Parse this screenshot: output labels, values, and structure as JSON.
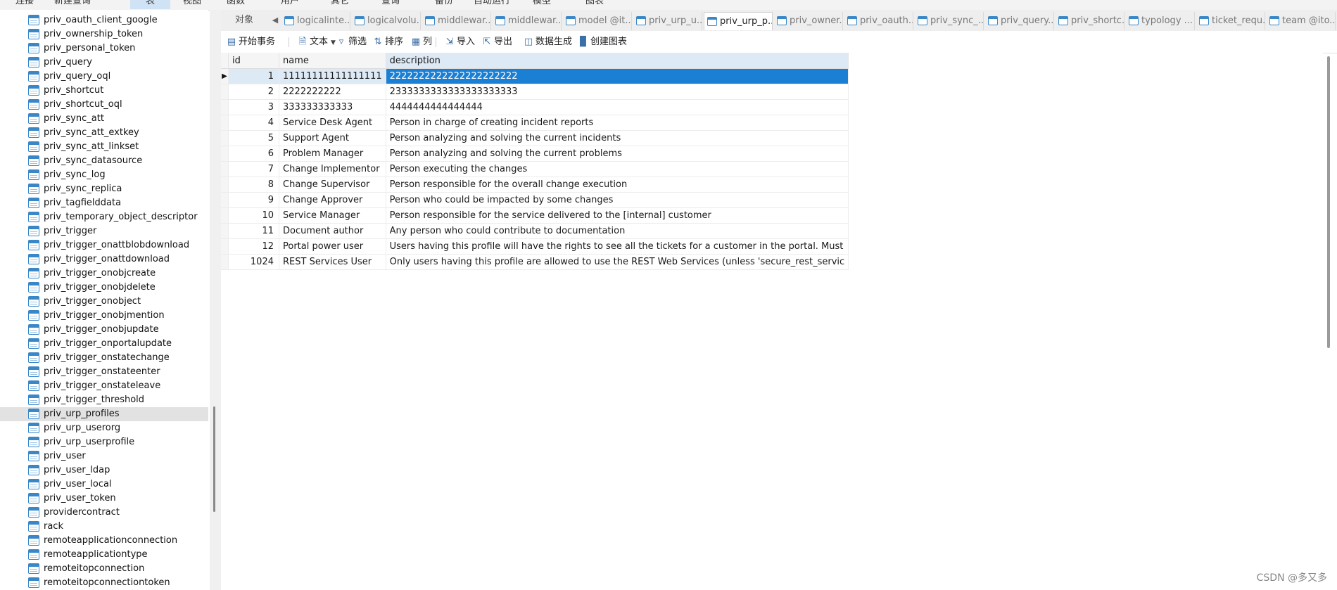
{
  "top_menu": [
    "连接",
    "新建查询",
    "表",
    "视图",
    "函数",
    "用户",
    "其它",
    "查询",
    "备份",
    "自动运行",
    "模型",
    "图表"
  ],
  "top_menu_active": "表",
  "sidebar": {
    "items": [
      "priv_oauth_client_google",
      "priv_ownership_token",
      "priv_personal_token",
      "priv_query",
      "priv_query_oql",
      "priv_shortcut",
      "priv_shortcut_oql",
      "priv_sync_att",
      "priv_sync_att_extkey",
      "priv_sync_att_linkset",
      "priv_sync_datasource",
      "priv_sync_log",
      "priv_sync_replica",
      "priv_tagfielddata",
      "priv_temporary_object_descriptor",
      "priv_trigger",
      "priv_trigger_onattblobdownload",
      "priv_trigger_onattdownload",
      "priv_trigger_onobjcreate",
      "priv_trigger_onobjdelete",
      "priv_trigger_onobject",
      "priv_trigger_onobjmention",
      "priv_trigger_onobjupdate",
      "priv_trigger_onportalupdate",
      "priv_trigger_onstatechange",
      "priv_trigger_onstateenter",
      "priv_trigger_onstateleave",
      "priv_trigger_threshold",
      "priv_urp_profiles",
      "priv_urp_userorg",
      "priv_urp_userprofile",
      "priv_user",
      "priv_user_ldap",
      "priv_user_local",
      "priv_user_token",
      "providercontract",
      "rack",
      "remoteapplicationconnection",
      "remoteapplicationtype",
      "remoteitopconnection",
      "remoteitopconnectiontoken"
    ],
    "selected": "priv_urp_profiles"
  },
  "tabs": {
    "objects_label": "对象",
    "items": [
      "logicalinte...",
      "logicalvolu...",
      "middlewar...",
      "middlewar...",
      "model @it...",
      "priv_urp_u...",
      "priv_urp_p...",
      "priv_owner...",
      "priv_oauth...",
      "priv_sync_...",
      "priv_query...",
      "priv_shortc...",
      "typology ...",
      "ticket_requ...",
      "team @ito..."
    ],
    "active_index": 6
  },
  "toolbar": {
    "begin_transaction": "开始事务",
    "text": "文本",
    "filter": "筛选",
    "sort": "排序",
    "columns": "列",
    "import": "导入",
    "export": "导出",
    "data_generation": "数据生成",
    "create_chart": "创建图表"
  },
  "grid": {
    "columns": [
      "id",
      "name",
      "description"
    ],
    "rows": [
      {
        "id": "1",
        "name": "11111111111111111",
        "description": "2222222222222222222222"
      },
      {
        "id": "2",
        "name": "2222222222",
        "description": "2333333333333333333333"
      },
      {
        "id": "3",
        "name": "333333333333",
        "description": "4444444444444444"
      },
      {
        "id": "4",
        "name": "Service Desk Agent",
        "description": "Person in charge of creating incident reports"
      },
      {
        "id": "5",
        "name": "Support Agent",
        "description": "Person analyzing and solving the current incidents"
      },
      {
        "id": "6",
        "name": "Problem Manager",
        "description": "Person analyzing and solving the current problems"
      },
      {
        "id": "7",
        "name": "Change Implementor",
        "description": "Person executing the changes"
      },
      {
        "id": "8",
        "name": "Change Supervisor",
        "description": "Person responsible for the overall change execution"
      },
      {
        "id": "9",
        "name": "Change Approver",
        "description": "Person who could be impacted by some changes"
      },
      {
        "id": "10",
        "name": "Service Manager",
        "description": "Person responsible for the service delivered to the [internal] customer"
      },
      {
        "id": "11",
        "name": "Document author",
        "description": "Any person who could contribute to documentation"
      },
      {
        "id": "12",
        "name": "Portal power user",
        "description": "Users having this profile will have the rights to see all the tickets for a customer in the portal. Must"
      },
      {
        "id": "1024",
        "name": "REST Services User",
        "description": "Only users having this profile are allowed to use the REST Web Services (unless 'secure_rest_servic"
      }
    ],
    "current_row_index": 0
  },
  "watermark": "CSDN @多又多",
  "colors": {
    "selection": "#1b7fd4",
    "table_icon": "#3a87c8",
    "sidebar_selected": "#e2e2e2"
  }
}
